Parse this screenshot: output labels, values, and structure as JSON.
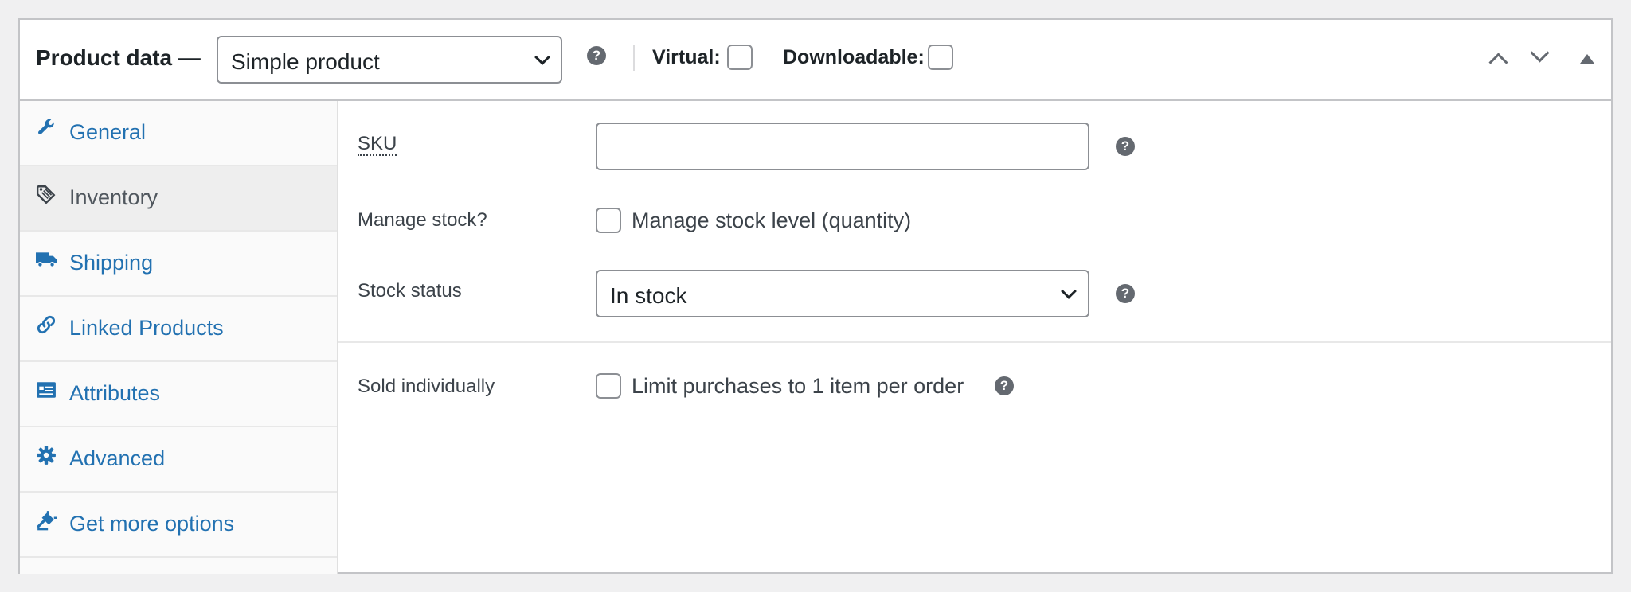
{
  "header": {
    "title": "Product data —",
    "product_type": "Simple product",
    "virtual_label": "Virtual:",
    "downloadable_label": "Downloadable:",
    "help_glyph": "?"
  },
  "sidebar": {
    "active_tab": "Inventory",
    "tabs": [
      {
        "label": "General",
        "icon": "wrench-icon"
      },
      {
        "label": "Inventory",
        "icon": "tag-icon"
      },
      {
        "label": "Shipping",
        "icon": "truck-icon"
      },
      {
        "label": "Linked Products",
        "icon": "link-icon"
      },
      {
        "label": "Attributes",
        "icon": "list-card-icon"
      },
      {
        "label": "Advanced",
        "icon": "gear-icon"
      },
      {
        "label": "Get more options",
        "icon": "plugin-icon"
      }
    ]
  },
  "inventory": {
    "sku_label": "SKU",
    "sku_value": "",
    "manage_stock_label": "Manage stock?",
    "manage_stock_checkbox_label": "Manage stock level (quantity)",
    "stock_status_label": "Stock status",
    "stock_status_value": "In stock",
    "sold_individually_label": "Sold individually",
    "sold_individually_checkbox_label": "Limit purchases to 1 item per order"
  },
  "colors": {
    "link": "#2271b1",
    "active_tab_bg": "#eeeeee",
    "border": "#c3c4c7",
    "help_icon": "#646970"
  }
}
